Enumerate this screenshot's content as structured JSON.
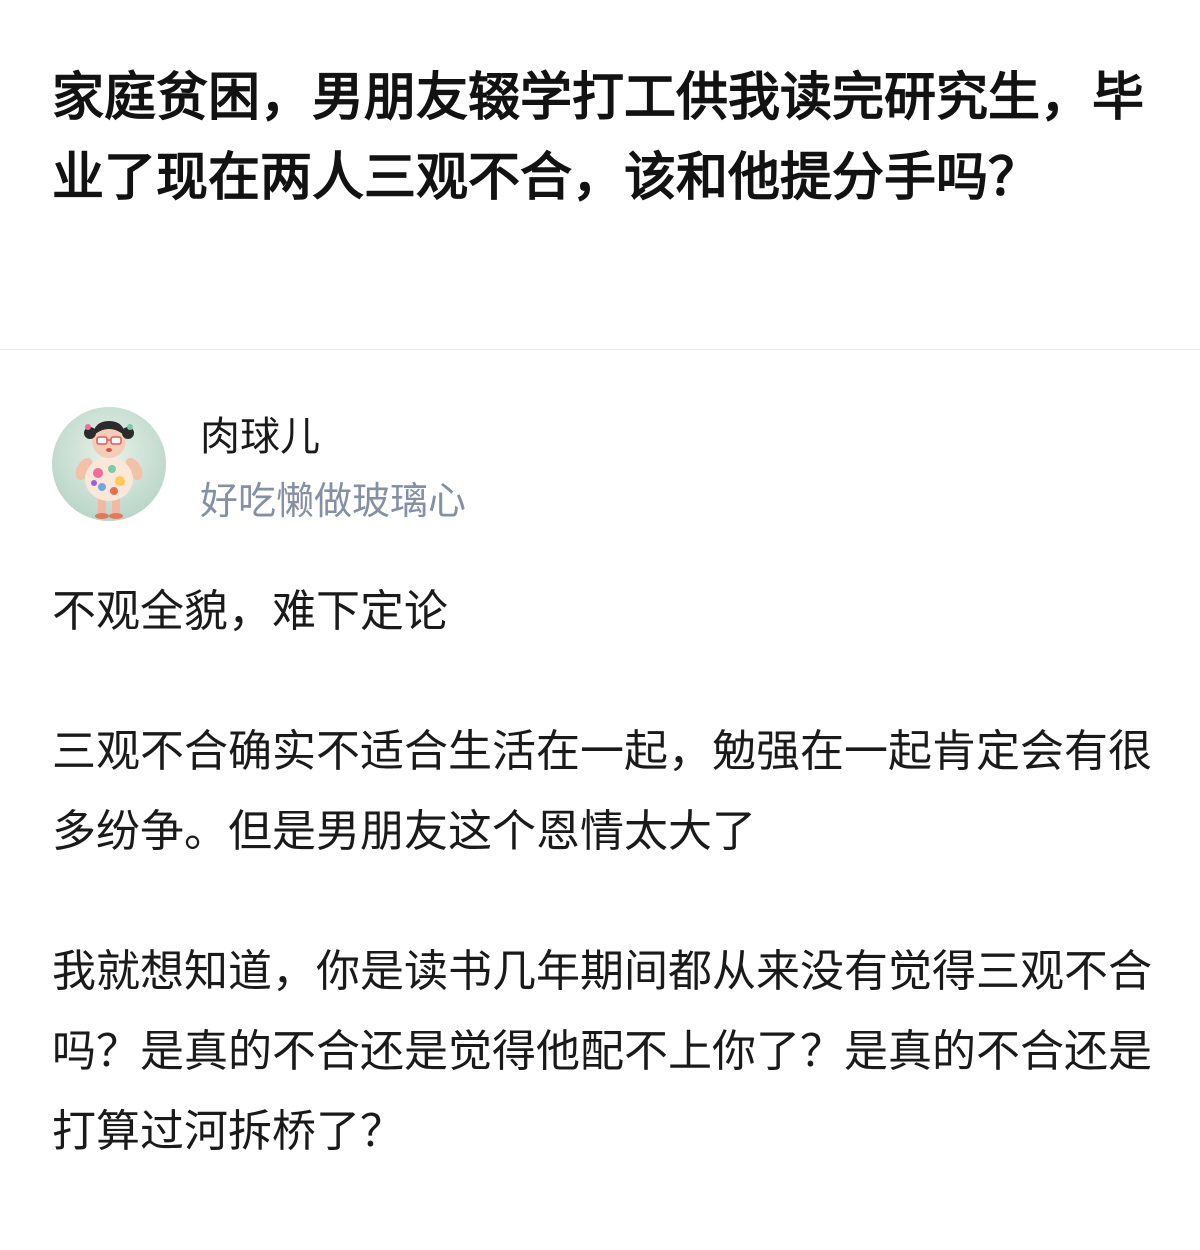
{
  "question": {
    "title": "家庭贫困，男朋友辍学打工供我读完研究生，毕业了现在两人三观不合，该和他提分手吗？"
  },
  "answer": {
    "author": {
      "name": "肉球儿",
      "bio": "好吃懒做玻璃心",
      "avatar_icon": "avatar-cartoon-girl-icon"
    },
    "paragraphs": [
      "不观全貌，难下定论",
      "三观不合确实不适合生活在一起，勉强在一起肯定会有很多纷争。但是男朋友这个恩情太大了",
      "我就想知道，你是读书几年期间都从来没有觉得三观不合吗？是真的不合还是觉得他配不上你了？是真的不合还是打算过河拆桥了？"
    ]
  },
  "colors": {
    "title": "#121212",
    "body_text": "#1a1a1a",
    "bio_text": "#8590a6",
    "divider": "#ebebeb",
    "background": "#ffffff"
  }
}
